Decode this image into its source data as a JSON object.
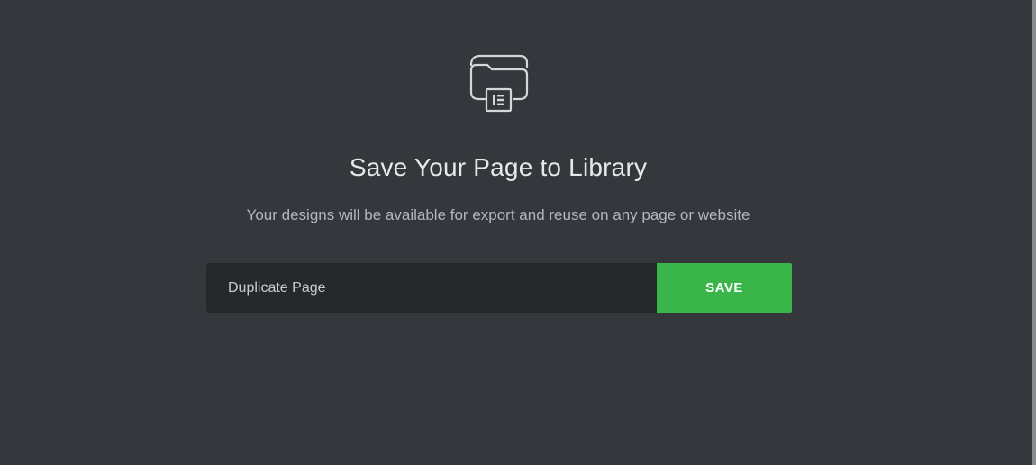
{
  "dialog": {
    "icon": "folder-library-icon",
    "title": "Save Your Page to Library",
    "subtitle": "Your designs will be available for export and reuse on any page or website"
  },
  "form": {
    "input_value": "Duplicate Page",
    "save_label": "SAVE"
  },
  "colors": {
    "background": "#34373c",
    "input_background": "#26282c",
    "accent": "#39b54a"
  }
}
